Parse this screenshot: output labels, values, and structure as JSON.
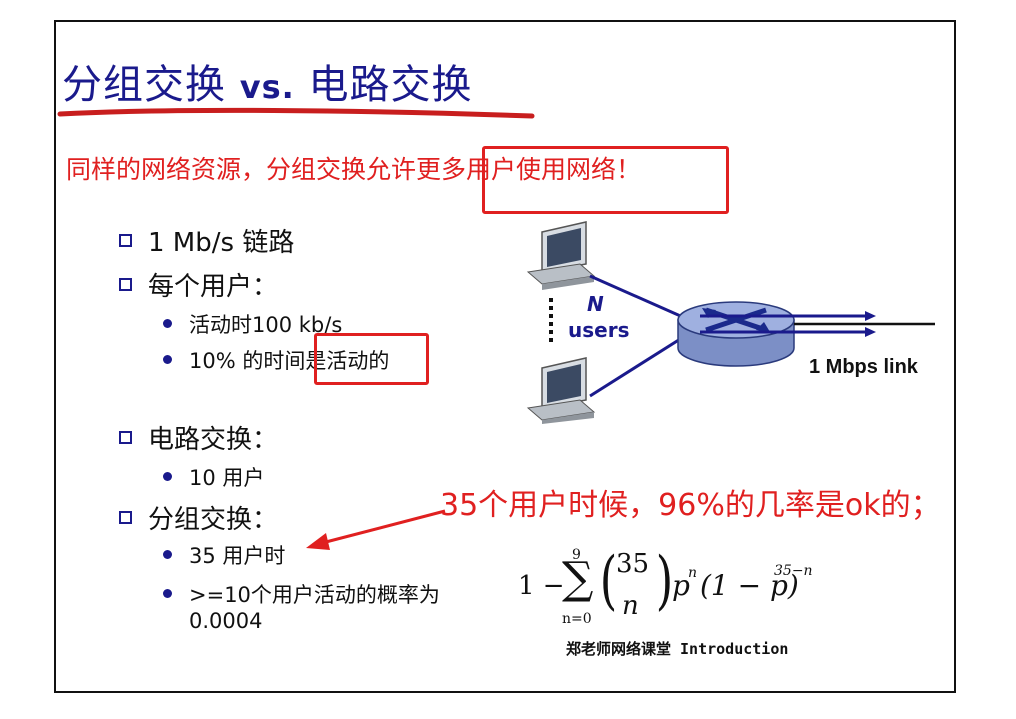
{
  "slide": {
    "title_part1": "分组交换 ",
    "title_vs": "vs.",
    "title_part2": " 电路交换",
    "subtitle_before": "同样的网络资源，分组交换",
    "subtitle_highlight": "允许更多用户使用",
    "subtitle_after": "网络！",
    "bullets": {
      "link": "1 Mb/s 链路",
      "per_user": "每个用户：",
      "active_rate": "活动时100 kb/s",
      "active_time_before": "10% 的时间",
      "active_time_highlight": "是活动的",
      "circuit": "电路交换：",
      "circuit_users": "10 用户",
      "packet": "分组交换：",
      "packet_users": "35 用户时",
      "prob_line1": ">=10个用户活动的概率为",
      "prob_line2": "0.0004"
    },
    "diagram": {
      "n_label": "N",
      "users_label": "users",
      "link_label": "1 Mbps link"
    },
    "annotation": "35个用户时候，96%的几率是ok的；",
    "formula": {
      "one_minus": "1 −",
      "sum_upper": "9",
      "sum_lower": "n=0",
      "binom_top": "35",
      "binom_bottom": "n",
      "p": "p",
      "n_exp": "n",
      "one_minus_p": "(1 − p)",
      "exp2": "35−n"
    },
    "footer": "郑老师网络课堂  Introduction",
    "colors": {
      "title": "#1a1a8c",
      "highlight_red": "#e02020",
      "bullet": "#1a1a8c"
    }
  }
}
